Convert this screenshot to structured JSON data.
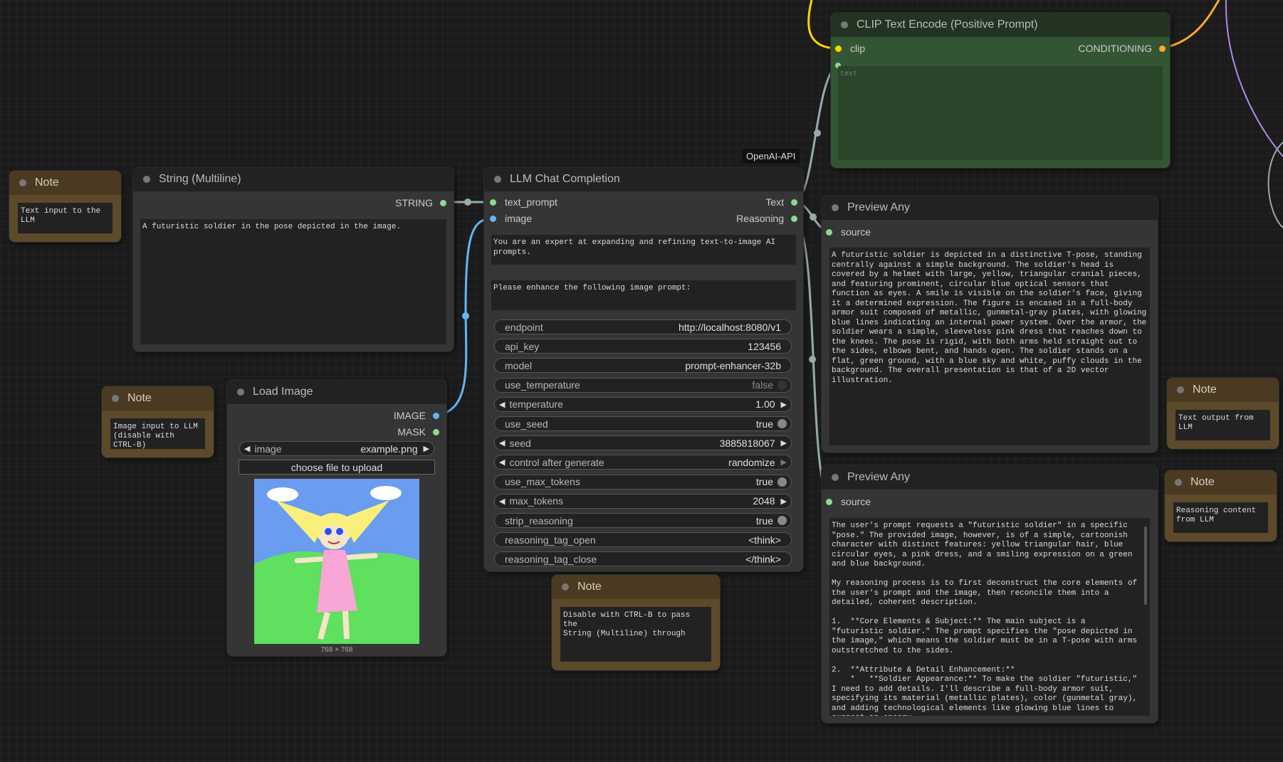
{
  "colors": {
    "clip": "#ffd500",
    "conditioning": "#ffa931",
    "image": "#64b5f6",
    "string": "#8fd88f",
    "generic": "#9aa",
    "vae": "#b18ae6"
  },
  "notes": [
    {
      "title": "Note",
      "text": "Text input to the LLM"
    },
    {
      "title": "Note",
      "text": "Image input to LLM\n(disable with CTRL-B)"
    },
    {
      "title": "Note",
      "text": "Disable with CTRL-B to pass the\nString (Multiline) through"
    },
    {
      "title": "Note",
      "text": "Text output from LLM"
    },
    {
      "title": "Note",
      "text": "Reasoning content\nfrom LLM"
    }
  ],
  "string_node": {
    "title": "String (Multiline)",
    "output": "STRING",
    "text": "A futuristic soldier in the pose depicted in the image."
  },
  "load_image": {
    "title": "Load Image",
    "outputs": [
      "IMAGE",
      "MASK"
    ],
    "image_label": "image",
    "image_value": "example.png",
    "upload_label": "choose file to upload",
    "dims": "768 × 768"
  },
  "llm": {
    "badge": "OpenAI-API",
    "title": "LLM Chat Completion",
    "inputs": [
      "text_prompt",
      "image"
    ],
    "outputs": [
      "Text",
      "Reasoning"
    ],
    "system_prompt": "You are an expert at expanding and refining text-to-image AI prompts.",
    "user_prompt": "Please enhance the following image prompt:",
    "widgets": [
      {
        "label": "endpoint",
        "value": "http://localhost:8080/v1",
        "kind": "text"
      },
      {
        "label": "api_key",
        "value": "123456",
        "kind": "text"
      },
      {
        "label": "model",
        "value": "prompt-enhancer-32b",
        "kind": "text"
      },
      {
        "label": "use_temperature",
        "value": "false",
        "kind": "toggle-off"
      },
      {
        "label": "temperature",
        "value": "1.00",
        "kind": "number"
      },
      {
        "label": "use_seed",
        "value": "true",
        "kind": "toggle"
      },
      {
        "label": "seed",
        "value": "3885818067",
        "kind": "number"
      },
      {
        "label": "control after generate",
        "value": "randomize",
        "kind": "combo"
      },
      {
        "label": "use_max_tokens",
        "value": "true",
        "kind": "toggle"
      },
      {
        "label": "max_tokens",
        "value": "2048",
        "kind": "number"
      },
      {
        "label": "strip_reasoning",
        "value": "true",
        "kind": "toggle"
      },
      {
        "label": "reasoning_tag_open",
        "value": "<think>",
        "kind": "text"
      },
      {
        "label": "reasoning_tag_close",
        "value": "</think>",
        "kind": "text"
      }
    ]
  },
  "clip": {
    "title": "CLIP Text Encode (Positive Prompt)",
    "input": "clip",
    "output": "CONDITIONING",
    "placeholder": "text"
  },
  "preview1": {
    "title": "Preview Any",
    "input": "source",
    "text": "A futuristic soldier is depicted in a distinctive T-pose, standing centrally against a simple background. The soldier's head is covered by a helmet with large, yellow, triangular cranial pieces, and featuring prominent, circular blue optical sensors that function as eyes. A smile is visible on the soldier's face, giving it a determined expression. The figure is encased in a full-body armor suit composed of metallic, gunmetal-gray plates, with glowing blue lines indicating an internal power system. Over the armor, the soldier wears a simple, sleeveless pink dress that reaches down to the knees. The pose is rigid, with both arms held straight out to the sides, elbows bent, and hands open. The soldier stands on a flat, green ground, with a blue sky and white, puffy clouds in the background. The overall presentation is that of a 2D vector illustration."
  },
  "preview2": {
    "title": "Preview Any",
    "input": "source",
    "text": "The user's prompt requests a \"futuristic soldier\" in a specific \"pose.\" The provided image, however, is of a simple, cartoonish character with distinct features: yellow triangular hair, blue circular eyes, a pink dress, and a smiling expression on a green and blue background.\n\nMy reasoning process is to first deconstruct the core elements of the user's prompt and the image, then reconcile them into a detailed, coherent description.\n\n1.  **Core Elements & Subject:** The main subject is a \"futuristic soldier.\" The prompt specifies the \"pose depicted in the image,\" which means the soldier must be in a T-pose with arms outstretched to the sides.\n\n2.  **Attribute & Detail Enhancement:**\n    *   **Soldier Appearance:** To make the soldier \"futuristic,\" I need to add details. I'll describe a full-body armor suit, specifying its material (metallic plates), color (gunmetal gray), and adding technological elements like glowing blue lines to suggest an energy"
  }
}
